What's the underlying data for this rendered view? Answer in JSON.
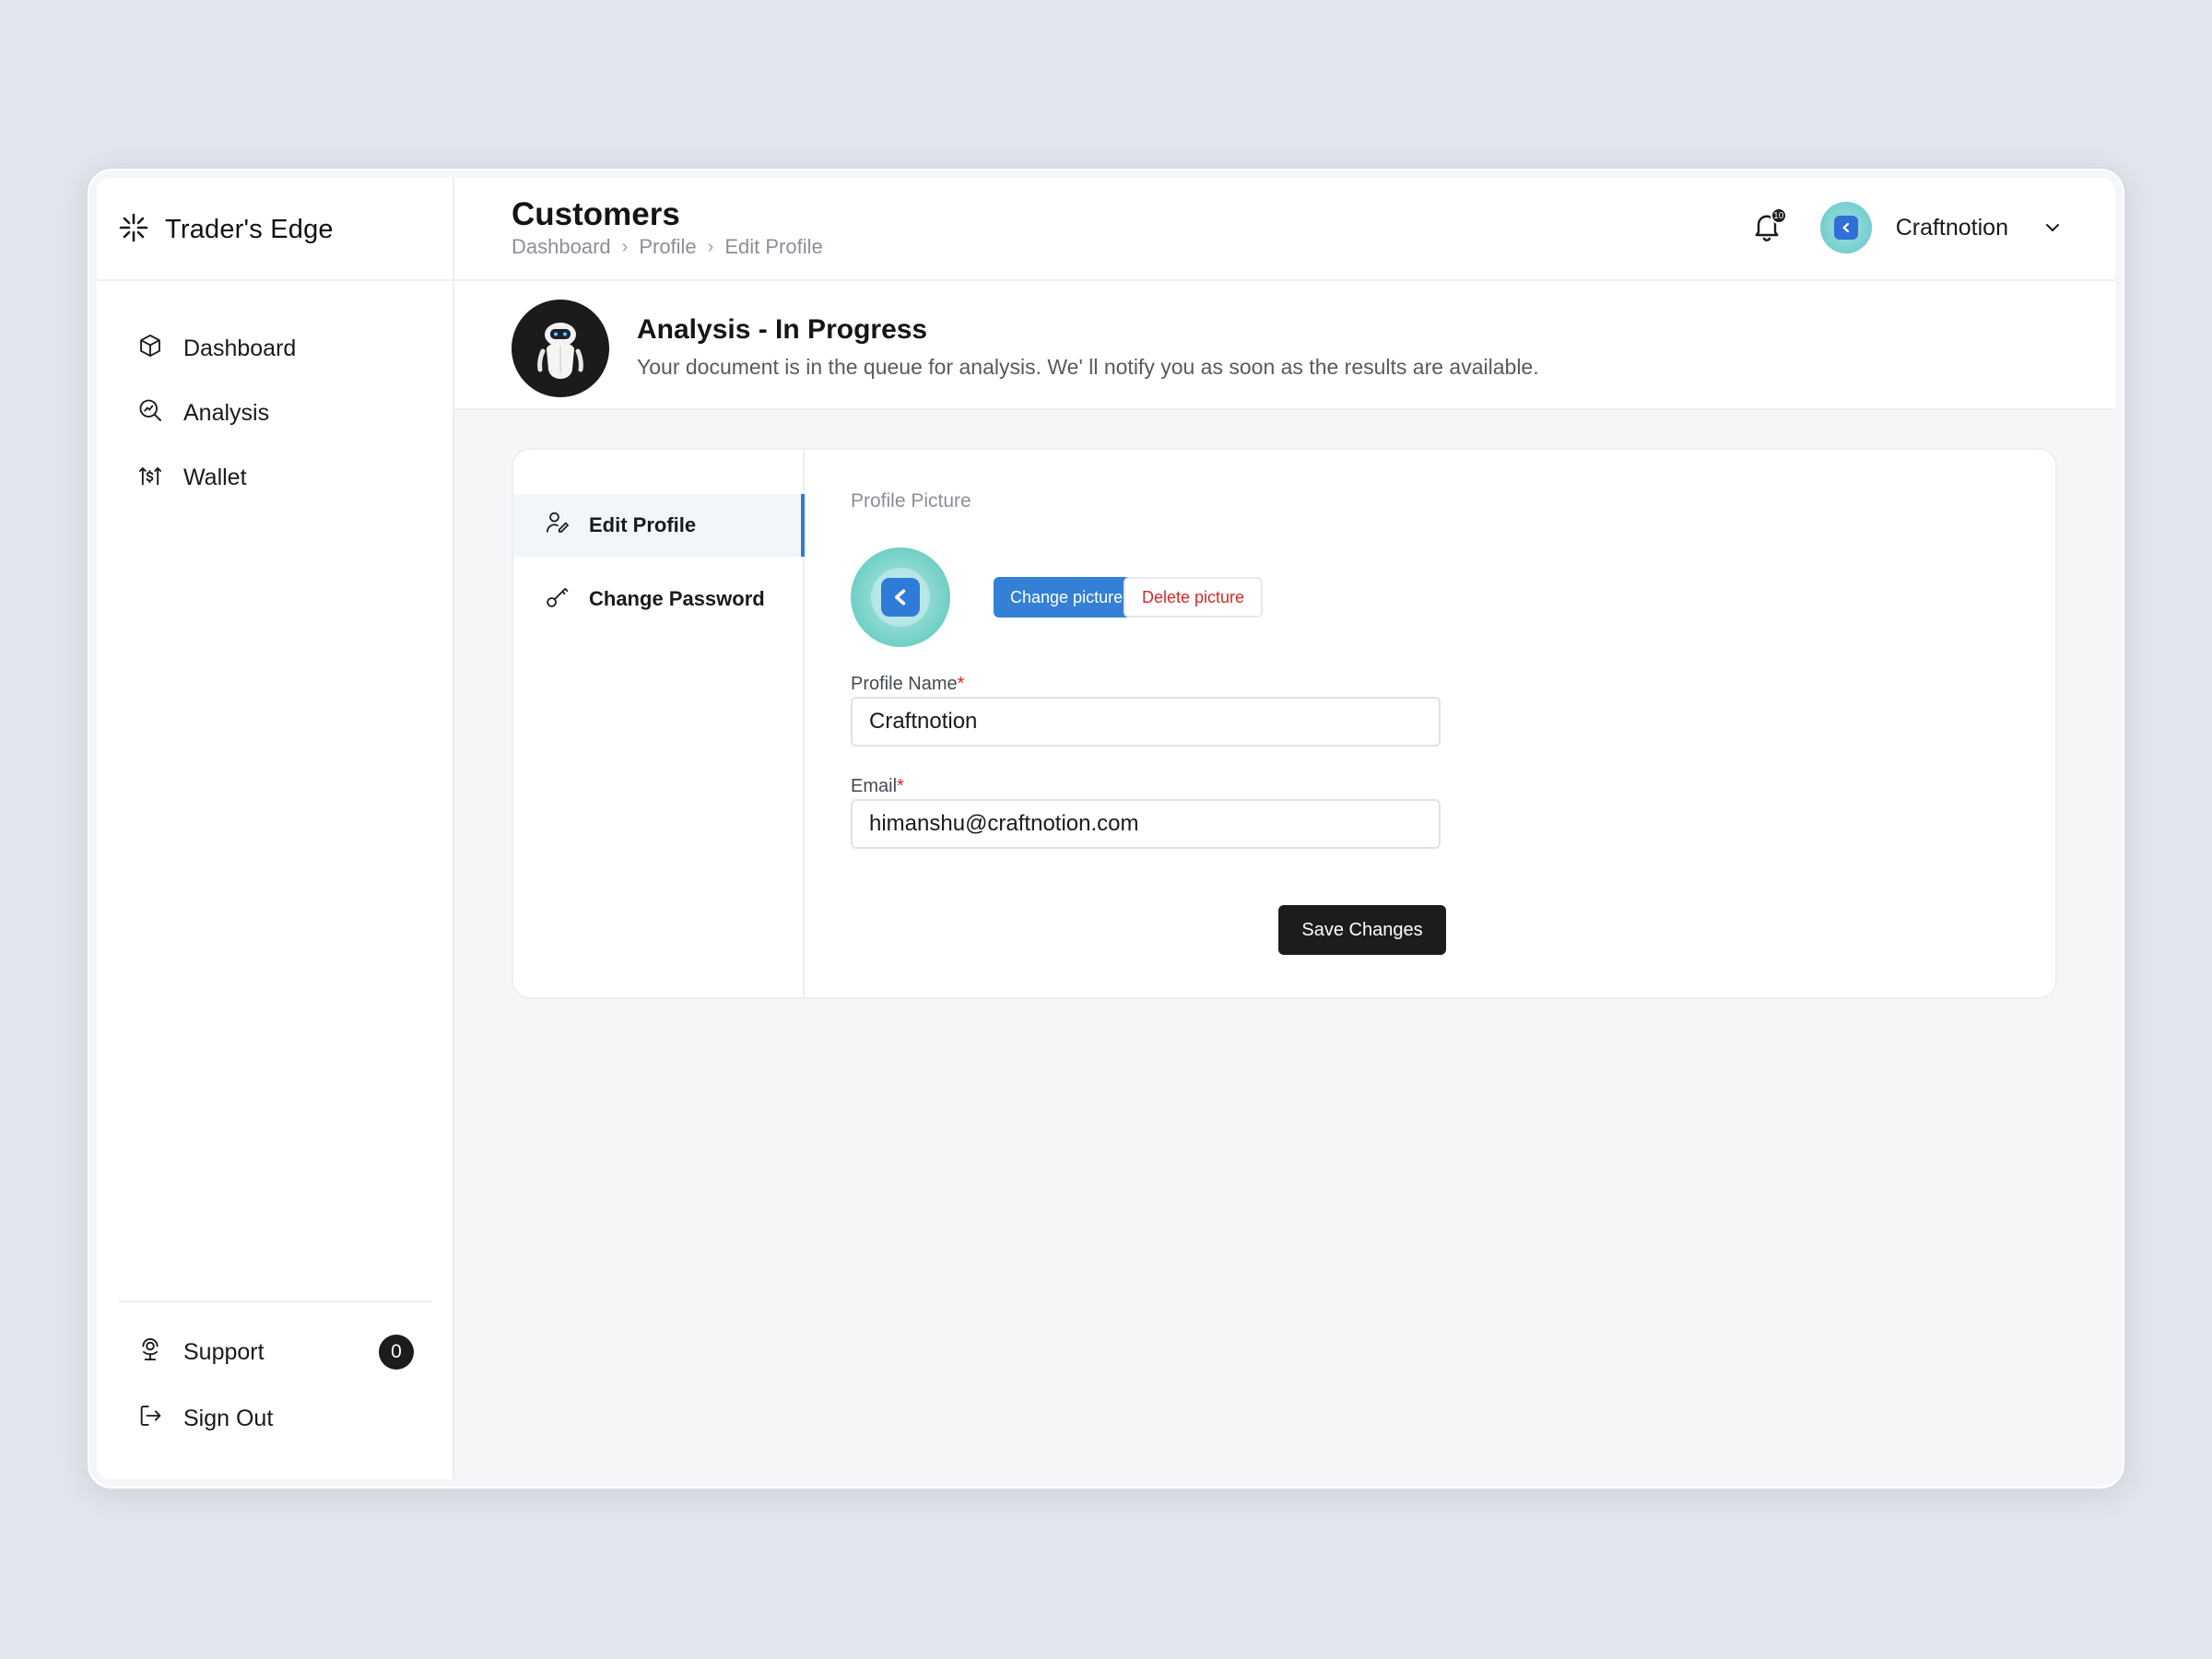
{
  "brand": {
    "name": "Trader's Edge",
    "icon": "sparkle-icon"
  },
  "sidebar": {
    "items": [
      {
        "label": "Dashboard",
        "icon": "cube-icon"
      },
      {
        "label": "Analysis",
        "icon": "search-analytics-icon"
      },
      {
        "label": "Wallet",
        "icon": "wallet-arrows-icon"
      }
    ],
    "bottom": [
      {
        "label": "Support",
        "icon": "support-icon",
        "badge": "0"
      },
      {
        "label": "Sign Out",
        "icon": "sign-out-icon"
      }
    ]
  },
  "header": {
    "title": "Customers",
    "breadcrumb": [
      "Dashboard",
      "Profile",
      "Edit Profile"
    ],
    "notification_count": "10",
    "user_name": "Craftnotion"
  },
  "banner": {
    "title": "Analysis - In Progress",
    "text": "Your document is in the queue for analysis. We' ll notify you as soon as the results are available."
  },
  "profile": {
    "tabs": [
      {
        "label": "Edit Profile",
        "icon": "user-edit-icon",
        "active": true
      },
      {
        "label": "Change Password",
        "icon": "key-icon",
        "active": false
      }
    ],
    "picture_label": "Profile Picture",
    "change_picture": "Change picture",
    "delete_picture": "Delete picture",
    "name_label": "Profile Name",
    "name_value": "Craftnotion",
    "email_label": "Email",
    "email_value": "himanshu@craftnotion.com",
    "required_mark": "*",
    "save_label": "Save Changes"
  },
  "colors": {
    "accent": "#3480d6",
    "danger": "#d42a2a",
    "dark": "#1c1c1c",
    "background": "#e1e5ed"
  }
}
